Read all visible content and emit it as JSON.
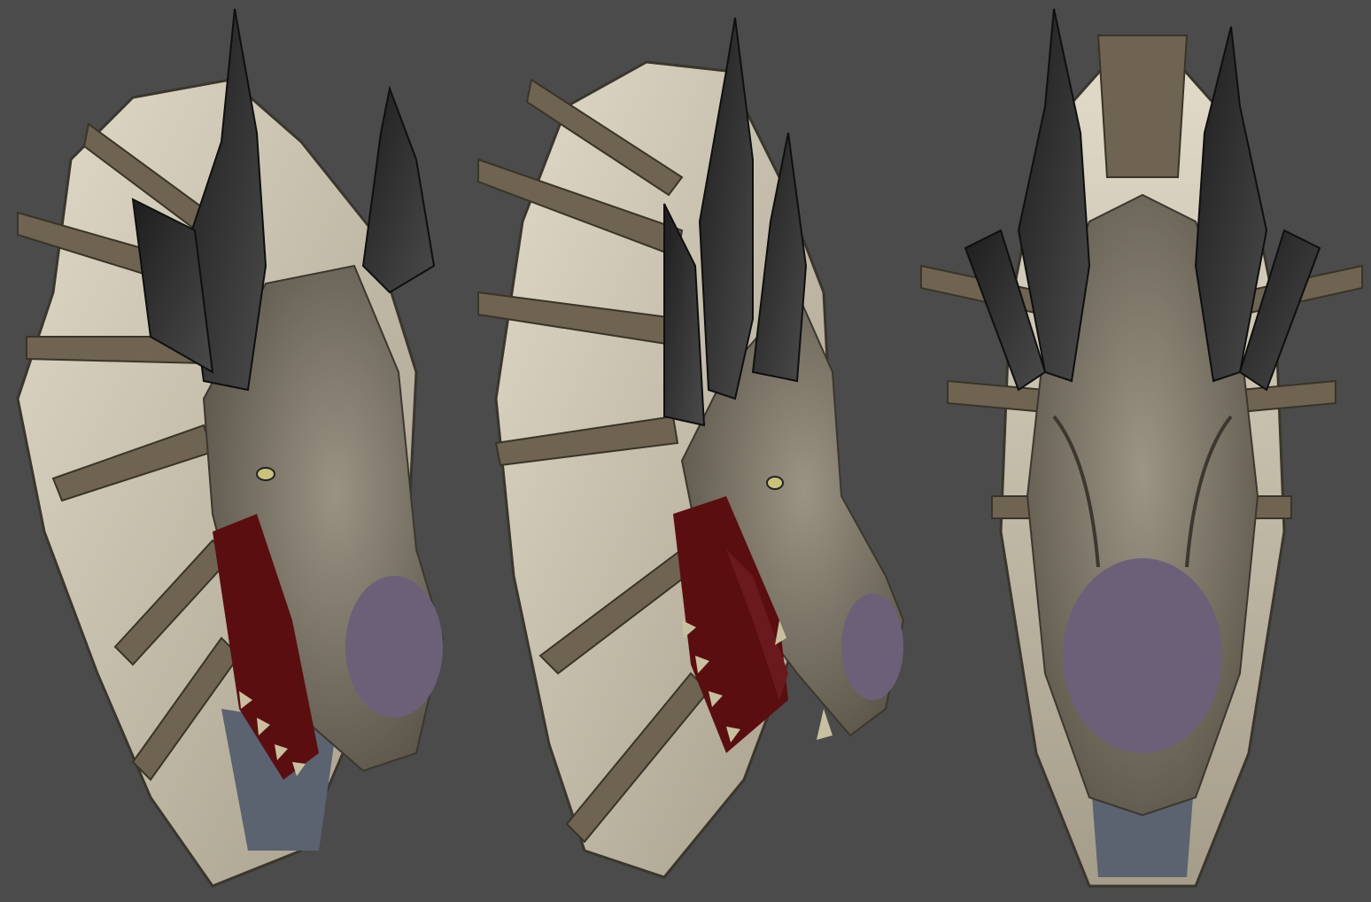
{
  "scene": {
    "background_color": "#4b4b4b",
    "views": [
      {
        "id": "three-quarter-left",
        "label": ""
      },
      {
        "id": "side-profile",
        "label": ""
      },
      {
        "id": "front",
        "label": ""
      }
    ],
    "colors": {
      "wing_membrane": "#d8d0bd",
      "spine_bone": "#6e6451",
      "horn": "#2c2c2c",
      "skin": "#8a8274",
      "snout": "#6b6078",
      "mouth": "#5a0e10",
      "teeth": "#c8c0a0",
      "neck_base": "#5b6270"
    }
  }
}
